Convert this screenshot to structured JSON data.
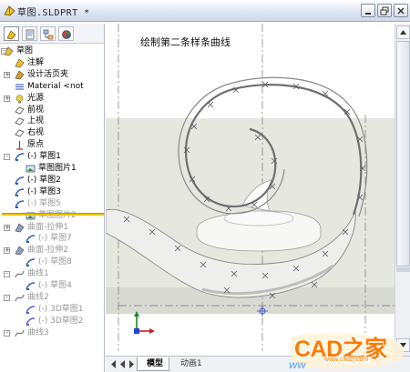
{
  "window": {
    "title": "草图.SLDPRT *"
  },
  "sidebar": {
    "tabs": [
      "feature-manager",
      "property-manager",
      "configuration-manager",
      "display-manager"
    ],
    "tree": [
      {
        "label": "草图",
        "icon": "part-icon",
        "expander": "-"
      },
      {
        "label": "注解",
        "icon": "annotation-icon"
      },
      {
        "label": "设计活页夹",
        "icon": "design-binder-icon",
        "expander": "+"
      },
      {
        "label": "Material <not",
        "icon": "material-icon"
      },
      {
        "label": "光源",
        "icon": "lights-icon",
        "expander": "+"
      },
      {
        "label": "前视",
        "icon": "plane-icon"
      },
      {
        "label": "上视",
        "icon": "plane-icon"
      },
      {
        "label": "右视",
        "icon": "plane-icon"
      },
      {
        "label": "原点",
        "icon": "origin-icon"
      },
      {
        "label": "(-) 草图1",
        "icon": "sketch-icon",
        "expander": "-"
      },
      {
        "label": "草图图片1",
        "icon": "sketch-picture-icon"
      },
      {
        "label": "(-) 草图2",
        "icon": "sketch-icon"
      },
      {
        "label": "(-) 草图3",
        "icon": "sketch-icon"
      },
      {
        "label": "(-) 草图5",
        "icon": "sketch-icon",
        "faded": true
      },
      {
        "label": "草图图片2",
        "icon": "sketch-picture-icon",
        "faded": true
      },
      {
        "label": "曲面-拉伸1",
        "icon": "surface-extrude-icon",
        "faded": true,
        "expander": "+"
      },
      {
        "label": "(-) 草图7",
        "icon": "sketch-icon",
        "faded": true
      },
      {
        "label": "曲面-拉伸2",
        "icon": "surface-extrude-icon",
        "faded": true,
        "expander": "+"
      },
      {
        "label": "(-) 草图8",
        "icon": "sketch-icon",
        "faded": true
      },
      {
        "label": "曲线1",
        "icon": "curve-icon",
        "faded": true,
        "expander": "-"
      },
      {
        "label": "(-) 草图4",
        "icon": "sketch-icon",
        "faded": true
      },
      {
        "label": "曲线2",
        "icon": "curve-icon",
        "faded": true,
        "expander": "-"
      },
      {
        "label": "(-) 3D草图1",
        "icon": "sketch3d-icon",
        "faded": true
      },
      {
        "label": "(-) 3D草图2",
        "icon": "sketch3d-icon",
        "faded": true
      },
      {
        "label": "曲线3",
        "icon": "curve-icon",
        "faded": true,
        "expander": "-"
      }
    ]
  },
  "viewport": {
    "caption": "绘制第二条样条曲线",
    "background_color": "#e8e8e0",
    "spline_color": "#7a7a7a"
  },
  "bottom_tabs": {
    "model": "模型",
    "animation": "动画1"
  },
  "watermark": {
    "brand": "CAD之家",
    "url": "www.cadzj.com",
    "side_text": "ww"
  },
  "colors": {
    "rollback_bar": "#e6c400",
    "watermark": "#ff7a00"
  }
}
